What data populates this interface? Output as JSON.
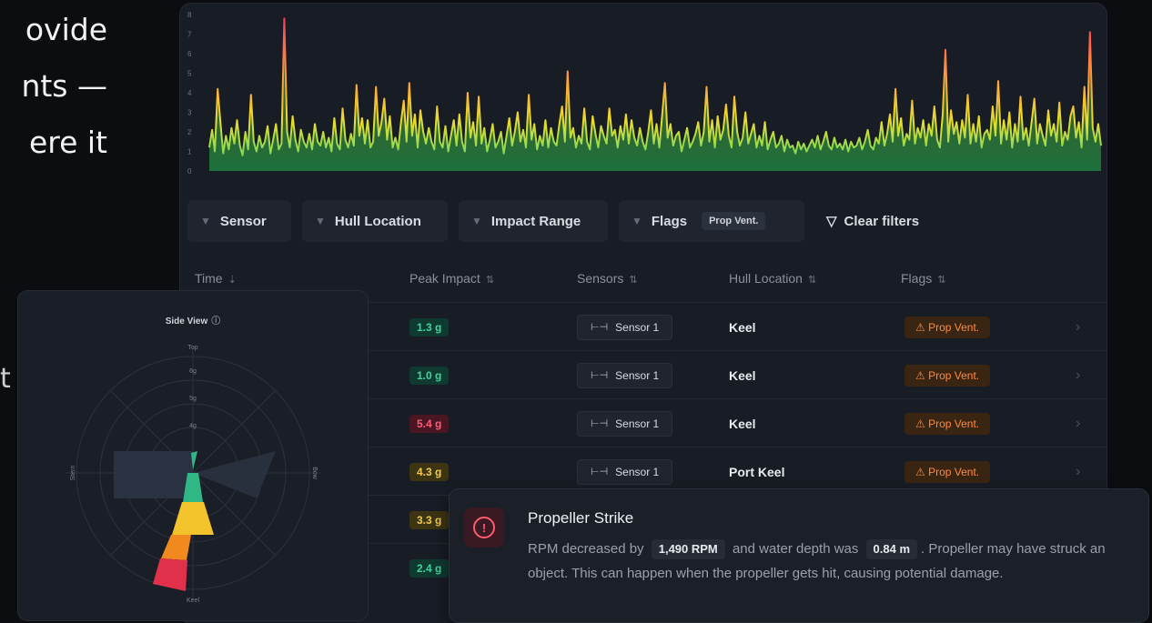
{
  "background_text": {
    "line1": "ovide",
    "line2": "nts —",
    "line3": "ere   it",
    "line4": "t"
  },
  "chart_data": {
    "type": "area",
    "ylim": [
      0,
      8
    ],
    "y_ticks": [
      "8",
      "7",
      "6",
      "5",
      "4",
      "3",
      "2",
      "1",
      "0"
    ],
    "y": [
      1.2,
      2.1,
      1.0,
      4.2,
      2.5,
      0.9,
      1.8,
      1.1,
      2.2,
      1.4,
      2.6,
      1.3,
      0.8,
      2.0,
      1.1,
      3.9,
      1.5,
      1.0,
      1.8,
      1.2,
      1.5,
      2.3,
      0.9,
      1.6,
      2.4,
      1.1,
      1.4,
      7.8,
      2.0,
      1.2,
      2.8,
      1.6,
      1.0,
      2.1,
      1.5,
      1.2,
      1.9,
      1.1,
      2.4,
      1.5,
      1.3,
      2.0,
      1.2,
      1.7,
      1.0,
      2.7,
      1.4,
      1.1,
      3.2,
      1.6,
      1.2,
      1.9,
      1.3,
      4.4,
      1.8,
      2.7,
      1.4,
      2.6,
      1.2,
      1.5,
      4.3,
      1.8,
      2.5,
      3.7,
      1.6,
      2.8,
      1.2,
      1.7,
      1.1,
      2.5,
      3.6,
      1.5,
      4.5,
      1.8,
      2.9,
      1.2,
      3.1,
      2.0,
      1.4,
      2.2,
      1.5,
      1.1,
      3.3,
      1.5,
      1.2,
      2.3,
      1.0,
      1.8,
      2.6,
      1.3,
      2.9,
      1.5,
      1.0,
      4.0,
      1.7,
      2.5,
      1.3,
      3.8,
      1.4,
      2.2,
      1.0,
      1.6,
      2.4,
      1.2,
      1.5,
      2.0,
      0.9,
      1.8,
      2.7,
      1.3,
      2.0,
      3.0,
      1.5,
      2.1,
      1.2,
      3.9,
      1.6,
      2.4,
      1.1,
      1.8,
      1.3,
      2.6,
      1.2,
      2.2,
      1.5,
      1.3,
      2.4,
      3.3,
      1.5,
      5.1,
      1.7,
      2.2,
      1.2,
      1.8,
      1.4,
      3.2,
      1.5,
      1.1,
      2.8,
      1.9,
      1.2,
      2.3,
      1.8,
      1.4,
      3.2,
      1.8,
      2.1,
      1.2,
      2.3,
      1.6,
      2.9,
      1.4,
      2.6,
      1.7,
      1.3,
      2.2,
      1.5,
      1.1,
      2.0,
      3.1,
      1.4,
      2.4,
      1.2,
      2.8,
      4.5,
      1.7,
      2.4,
      1.3,
      1.8,
      2.0,
      1.0,
      1.6,
      2.2,
      1.2,
      1.5,
      1.9,
      2.5,
      1.3,
      2.0,
      4.3,
      1.5,
      2.6,
      1.2,
      2.8,
      1.6,
      2.1,
      3.4,
      1.8,
      1.2,
      3.8,
      2.0,
      1.3,
      1.7,
      3.0,
      1.4,
      1.9,
      2.4,
      1.2,
      1.8,
      1.3,
      2.5,
      1.1,
      1.6,
      2.0,
      1.2,
      1.4,
      1.8,
      1.0,
      1.6,
      1.2,
      1.3,
      0.9,
      1.5,
      1.1,
      1.4,
      1.0,
      1.3,
      1.6,
      1.2,
      1.8,
      1.1,
      1.5,
      2.0,
      1.3,
      1.1,
      1.7,
      1.2,
      1.4,
      1.1,
      1.6,
      1.0,
      1.5,
      1.2,
      1.3,
      1.7,
      1.1,
      1.5,
      2.1,
      1.3,
      1.1,
      1.7,
      1.4,
      2.5,
      1.3,
      1.9,
      2.9,
      1.5,
      4.2,
      1.8,
      2.7,
      1.3,
      1.9,
      1.6,
      3.6,
      1.4,
      2.2,
      1.7,
      2.6,
      1.3,
      2.4,
      1.8,
      3.3,
      1.6,
      1.2,
      2.9,
      6.2,
      1.5,
      3.1,
      1.9,
      2.5,
      1.4,
      2.6,
      1.7,
      3.9,
      1.4,
      2.4,
      1.5,
      2.8,
      1.2,
      1.9,
      2.1,
      1.6,
      3.3,
      1.8,
      4.6,
      1.4,
      2.6,
      1.6,
      3.0,
      1.2,
      2.4,
      1.5,
      3.8,
      1.6,
      2.2,
      1.3,
      2.5,
      3.7,
      1.4,
      2.4,
      1.8,
      1.3,
      3.1,
      1.8,
      2.4,
      1.5,
      3.5,
      1.3,
      2.0,
      1.6,
      2.8,
      3.3,
      1.7,
      2.5,
      1.2,
      4.3,
      1.6,
      7.1,
      2.2,
      1.5,
      2.4,
      1.3
    ]
  },
  "filters": {
    "sensor": "Sensor",
    "hull_location": "Hull Location",
    "impact_range": "Impact Range",
    "flags": "Flags",
    "flags_value": "Prop Vent.",
    "clear": "Clear filters"
  },
  "table": {
    "headers": [
      "Time",
      "Peak Impact",
      "Sensors",
      "Hull Location",
      "Flags"
    ],
    "rows": [
      {
        "peak": "1.3 g",
        "level": "green",
        "sensor": "Sensor 1",
        "hull": "Keel",
        "flag": "Prop Vent."
      },
      {
        "peak": "1.0 g",
        "level": "green",
        "sensor": "Sensor 1",
        "hull": "Keel",
        "flag": "Prop Vent."
      },
      {
        "peak": "5.4 g",
        "level": "red",
        "sensor": "Sensor 1",
        "hull": "Keel",
        "flag": "Prop Vent."
      },
      {
        "peak": "4.3 g",
        "level": "yellow",
        "sensor": "Sensor 1",
        "hull": "Port Keel",
        "flag": "Prop Vent."
      },
      {
        "peak": "3.3 g",
        "level": "yellow"
      },
      {
        "peak": "2.4 g",
        "level": "green"
      }
    ]
  },
  "side_view": {
    "title": "Side View",
    "top": "Top",
    "bottom": "Keel",
    "left": "Stern",
    "right": "Bow",
    "rings": [
      "6g",
      "5g",
      "4g"
    ],
    "colors": {
      "red": "#e0304a",
      "orange": "#f08a1e",
      "yellow": "#f2c32b",
      "green": "#2fb886",
      "sector": "#2a3140"
    }
  },
  "toast": {
    "title": "Propeller Strike",
    "text1": "RPM decreased by",
    "rpm": "1,490 RPM",
    "text2": "and water depth was",
    "depth": "0.84 m",
    "text3": ". Propeller may have struck an object. This can happen when the propeller gets hit, causing potential damage."
  }
}
